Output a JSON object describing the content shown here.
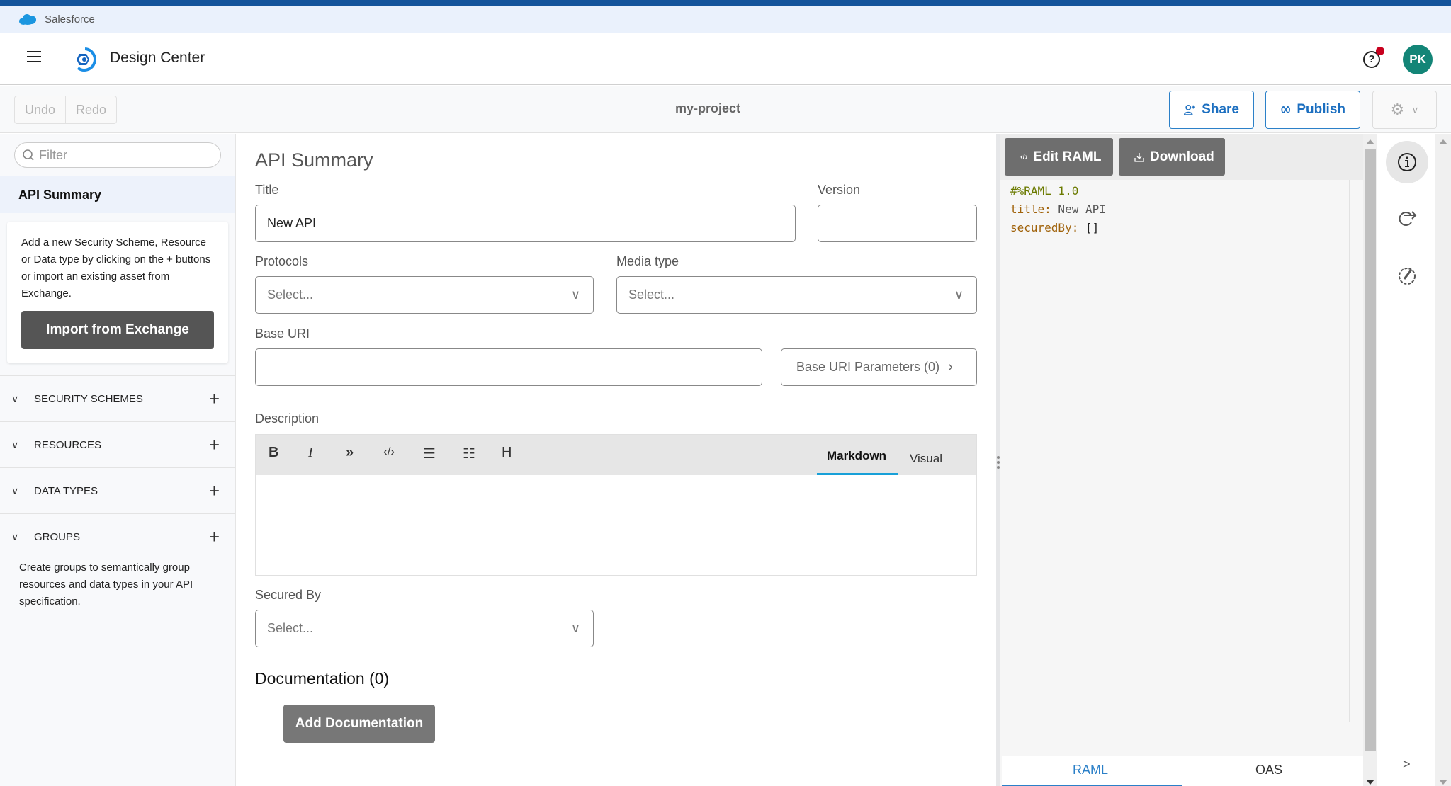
{
  "browser": {
    "org_label": "Salesforce",
    "org_icon": "salesforce-cloud-icon"
  },
  "header": {
    "app_title": "Design Center",
    "menu_icon": "hamburger-icon",
    "help_icon": "help-icon",
    "notification_color": "#c8001e",
    "avatar_initials": "PK",
    "avatar_color": "#138577"
  },
  "toolbar": {
    "undo_label": "Undo",
    "redo_label": "Redo",
    "project_name": "my-project",
    "share_label": "Share",
    "publish_label": "Publish",
    "settings_icon": "gear-icon"
  },
  "sidebar": {
    "filter_placeholder": "Filter",
    "selected_item": "API Summary",
    "info_text": "Add a new Security Scheme, Resource or Data type by clicking on the + buttons or import an existing asset from Exchange.",
    "import_button": "Import from Exchange",
    "sections": [
      {
        "label": "SECURITY SCHEMES"
      },
      {
        "label": "RESOURCES"
      },
      {
        "label": "DATA TYPES"
      },
      {
        "label": "GROUPS"
      }
    ],
    "groups_description": "Create groups to semantically group resources and data types in your API specification."
  },
  "main": {
    "heading": "API Summary",
    "title_label": "Title",
    "title_value": "New API",
    "version_label": "Version",
    "version_value": "",
    "protocols_label": "Protocols",
    "protocols_value": "Select...",
    "media_type_label": "Media type",
    "media_type_value": "Select...",
    "base_uri_label": "Base URI",
    "base_uri_value": "",
    "base_uri_params_label": "Base URI Parameters (0)",
    "description_label": "Description",
    "editor_tools": [
      "bold",
      "italic",
      "quote",
      "code",
      "ordered-list",
      "unordered-list",
      "heading"
    ],
    "editor_tabs": {
      "markdown": "Markdown",
      "visual": "Visual",
      "active": "Markdown"
    },
    "secured_by_label": "Secured By",
    "secured_by_value": "Select...",
    "documentation_heading": "Documentation (0)",
    "add_documentation_label": "Add Documentation"
  },
  "raml_panel": {
    "edit_label": "Edit RAML",
    "download_label": "Download",
    "code": [
      {
        "key": "#%RAML 1.0",
        "value": ""
      },
      {
        "key": "title:",
        "value": " New API"
      },
      {
        "key": "securedBy:",
        "value": " []"
      }
    ],
    "tabs": {
      "raml": "RAML",
      "oas": "OAS",
      "active": "RAML"
    },
    "colors": {
      "header": "#6b7a00",
      "key": "#a0620a",
      "accent": "#2b80c8"
    }
  },
  "rail": {
    "icons": [
      "info-icon",
      "share-forward-icon",
      "governance-icon"
    ],
    "collapse_label": ">"
  }
}
